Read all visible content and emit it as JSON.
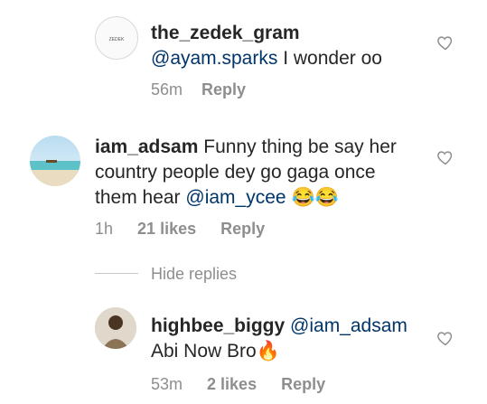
{
  "comments": [
    {
      "username": "the_zedek_gram",
      "mention": "@ayam.sparks",
      "text": " I wonder oo",
      "time": "56m",
      "reply": "Reply"
    },
    {
      "username": "iam_adsam",
      "text_line1": " Funny thing be say her",
      "text_line2": "country people dey go gaga once",
      "text_line3": "them hear ",
      "mention": "@iam_ycee",
      "emoji": "😂😂",
      "time": "1h",
      "likes": "21 likes",
      "reply": "Reply"
    },
    {
      "username": "highbee_biggy",
      "mention": "@iam_adsam",
      "text_line2": "Abi Now Bro",
      "emoji": "🔥",
      "time": "53m",
      "likes": "2 likes",
      "reply": "Reply"
    }
  ],
  "hide_replies": "Hide replies",
  "icons": {
    "like": "heart-outline-icon"
  }
}
